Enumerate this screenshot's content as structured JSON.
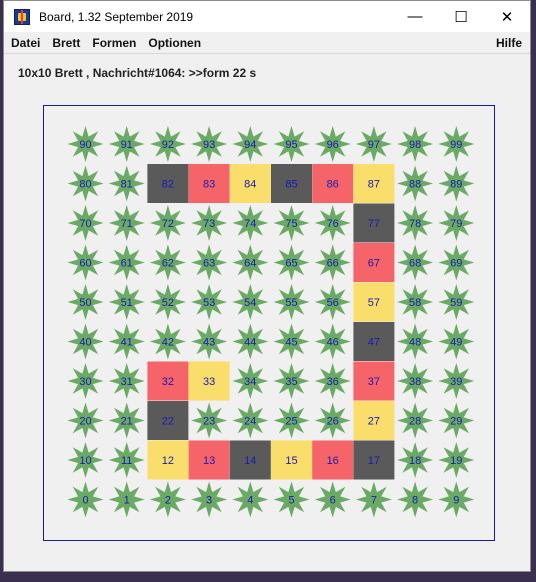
{
  "window": {
    "title": "Board, 1.32   September 2019",
    "controls": {
      "minimize": "—",
      "maximize": "☐",
      "close": "✕"
    }
  },
  "menu": {
    "items": [
      "Datei",
      "Brett",
      "Formen",
      "Optionen"
    ],
    "help": "Hilfe"
  },
  "status": "10x10 Brett , Nachricht#1064: >>form 22 s",
  "board": {
    "cols": 10,
    "rows": 10,
    "colors": {
      "star": "#6aaa64",
      "grey": "#5a5a5a",
      "red": "#f56468",
      "yellow": "#f9de6c",
      "label": "#1a1ab4",
      "frame": "#1a1aa0"
    },
    "cells": {
      "82": "grey",
      "83": "red",
      "84": "yellow",
      "85": "grey",
      "86": "red",
      "87": "yellow",
      "77": "grey",
      "67": "red",
      "57": "yellow",
      "47": "grey",
      "37": "red",
      "27": "yellow",
      "17": "grey",
      "16": "red",
      "15": "yellow",
      "14": "grey",
      "13": "red",
      "12": "yellow",
      "22": "grey",
      "32": "red",
      "33": "yellow"
    }
  }
}
